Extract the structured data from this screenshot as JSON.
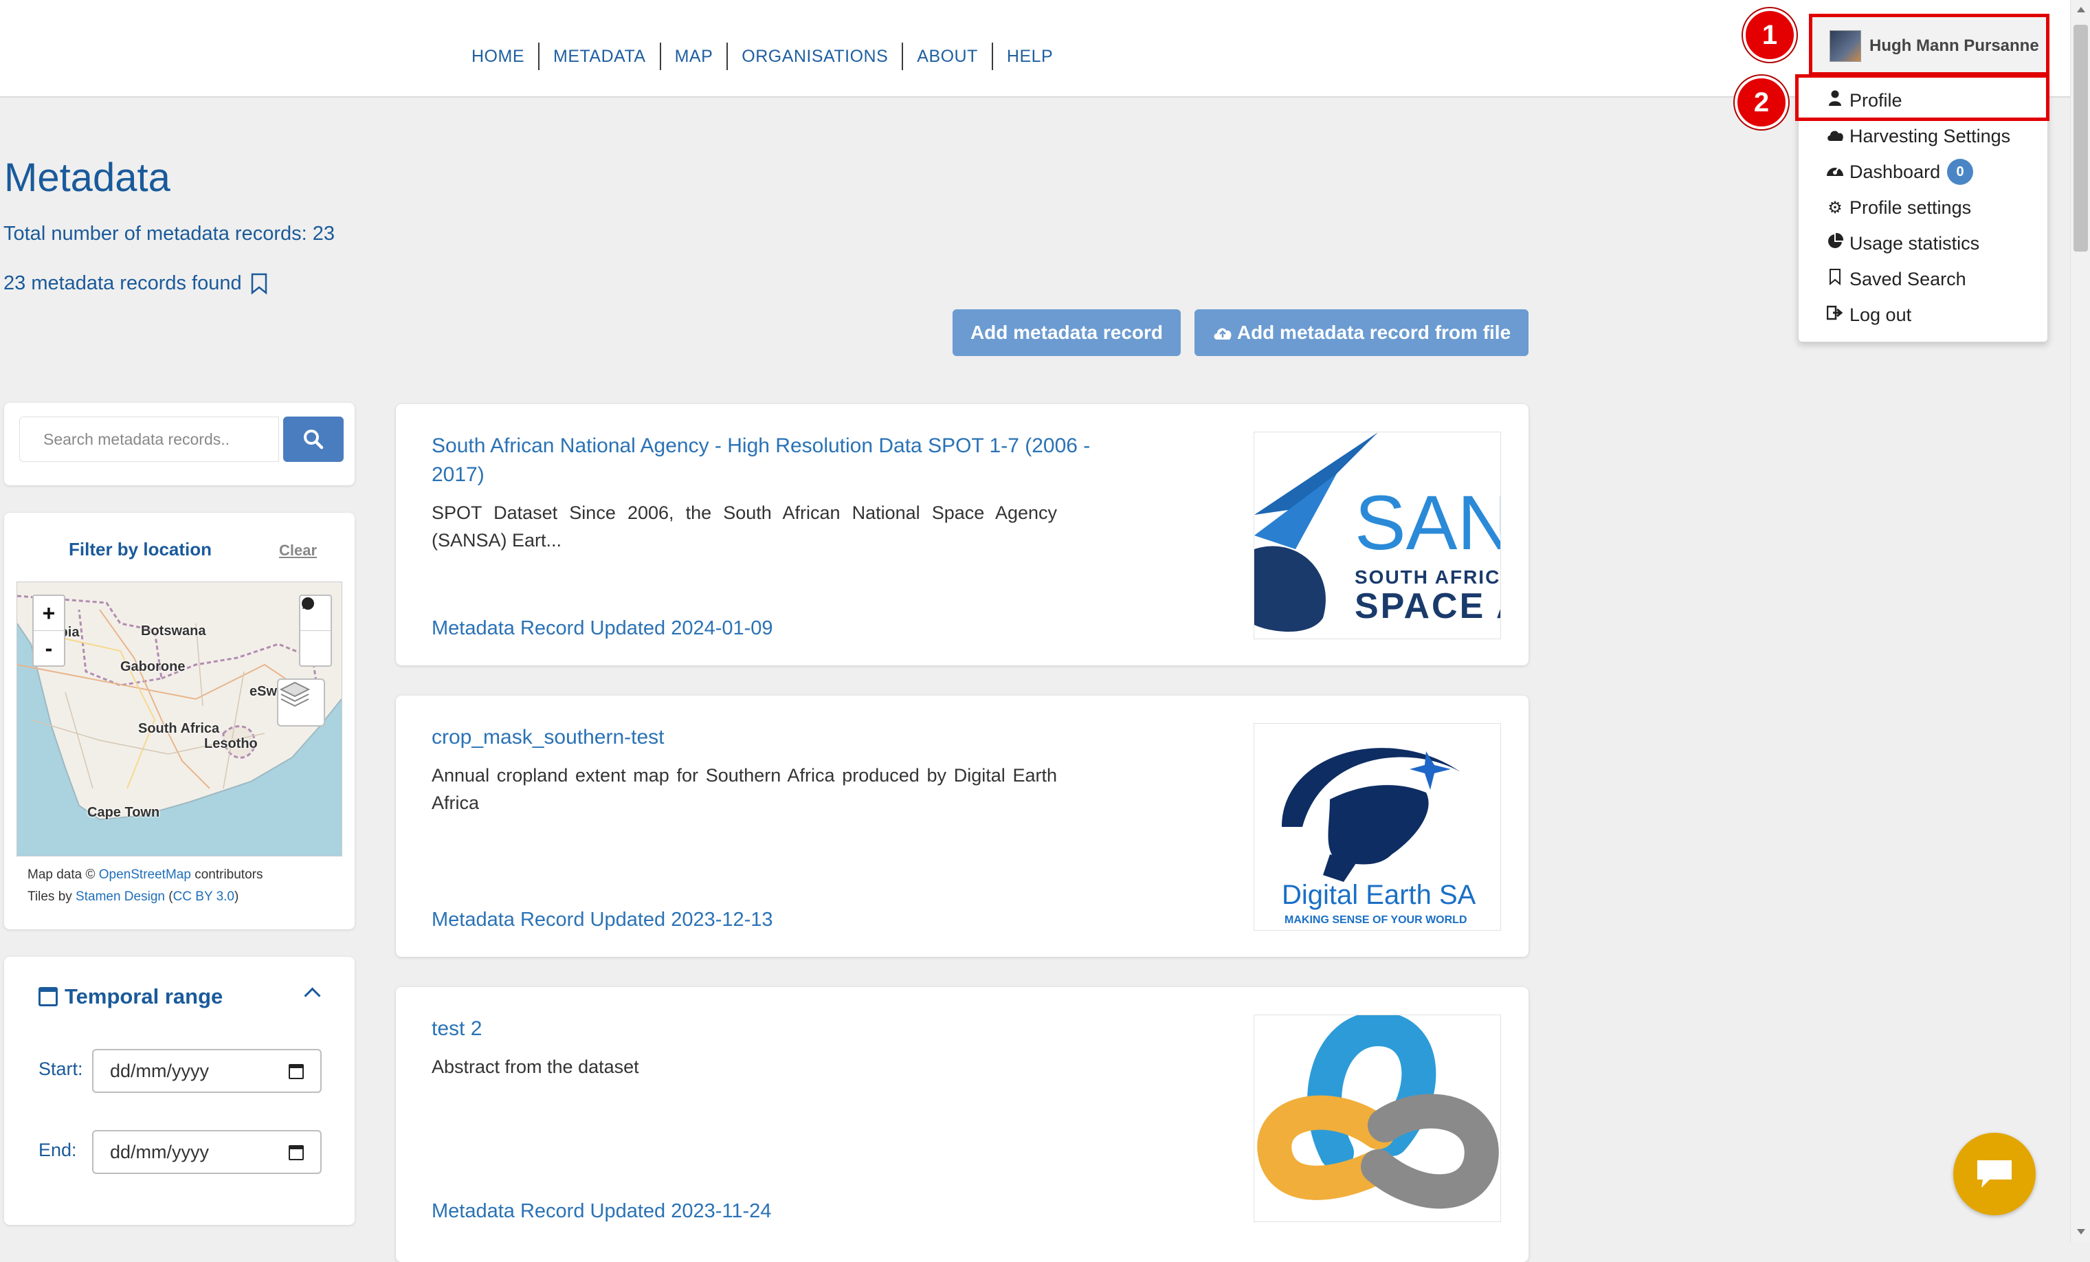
{
  "nav": {
    "items": [
      "HOME",
      "METADATA",
      "MAP",
      "ORGANISATIONS",
      "ABOUT",
      "HELP"
    ]
  },
  "user": {
    "name": "Hugh Mann Pursanne",
    "menu": [
      {
        "label": "Profile",
        "icon": "user-icon"
      },
      {
        "label": "Harvesting Settings",
        "icon": "cloud-icon"
      },
      {
        "label": "Dashboard",
        "icon": "dashboard-icon",
        "badge": "0"
      },
      {
        "label": "Profile settings",
        "icon": "gear-icon"
      },
      {
        "label": "Usage statistics",
        "icon": "pie-chart-icon"
      },
      {
        "label": "Saved Search",
        "icon": "bookmark-icon"
      },
      {
        "label": "Log out",
        "icon": "logout-icon"
      }
    ]
  },
  "annotations": {
    "marker1": "1",
    "marker2": "2"
  },
  "page": {
    "title": "Metadata",
    "total": "Total number of metadata records: 23",
    "found": "23 metadata records found"
  },
  "actions": {
    "add": "Add metadata record",
    "add_file": "Add metadata record from file"
  },
  "search": {
    "placeholder": "Search metadata records.."
  },
  "filter": {
    "title": "Filter by location",
    "clear": "Clear",
    "zoom_in": "+",
    "zoom_out": "-",
    "map_labels": [
      "ibia",
      "Botswana",
      "Gaborone",
      "eSw",
      "South Africa",
      "Lesotho",
      "Cape Town"
    ],
    "attrib1_pre": "Map data © ",
    "attrib1_link": "OpenStreetMap",
    "attrib1_post": " contributors",
    "attrib2_pre": "Tiles by ",
    "attrib2_link": "Stamen Design",
    "attrib2_mid": " (",
    "attrib2_link2": "CC BY 3.0",
    "attrib2_post": ")"
  },
  "temporal": {
    "title": "Temporal range",
    "start_label": "Start:",
    "end_label": "End:",
    "start_value": "dd/mm/yyyy",
    "end_value": "dd/mm/yyyy"
  },
  "records": [
    {
      "title": "South African National Agency - High Resolution Data SPOT 1-7 (2006 - 2017)",
      "abstract": "SPOT Dataset Since 2006, the South African National Space Agency (SANSA) Eart...",
      "updated": "Metadata Record Updated 2024-01-09",
      "logo_text": [
        "SAN",
        "SOUTH AFRICA",
        "SPACE A"
      ]
    },
    {
      "title": "crop_mask_southern-test",
      "abstract": "Annual cropland extent map for Southern Africa produced by Digital Earth Africa",
      "updated": "Metadata Record Updated 2023-12-13",
      "logo_text": [
        "Digital Earth SA",
        "MAKING SENSE OF YOUR WORLD"
      ]
    },
    {
      "title": "test 2",
      "abstract": "Abstract from the dataset",
      "updated": "Metadata Record Updated 2023-11-24"
    }
  ],
  "colors": {
    "brand_blue": "#1a5a9a",
    "link_blue": "#2a72b5",
    "button_blue": "#6b9bd1",
    "annotation_red": "#e10000",
    "chat_yellow": "#e3a600"
  }
}
